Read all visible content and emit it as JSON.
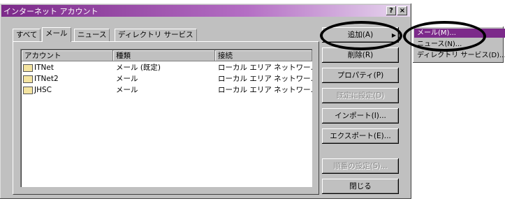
{
  "window": {
    "title": "インターネット アカウント",
    "help_label": "?",
    "close_label": "×"
  },
  "tabs": [
    {
      "label": "すべて"
    },
    {
      "label": "メール"
    },
    {
      "label": "ニュース"
    },
    {
      "label": "ディレクトリ サービス"
    }
  ],
  "columns": [
    "アカウント",
    "種類",
    "接続"
  ],
  "accounts": [
    {
      "name": "ITNet",
      "type": "メール (既定)",
      "connection": "ローカル エリア ネットワー..."
    },
    {
      "name": "ITNet2",
      "type": "メール",
      "connection": "ローカル エリア ネットワー..."
    },
    {
      "name": "JHSC",
      "type": "メール",
      "connection": "ローカル エリア ネットワー..."
    }
  ],
  "buttons": {
    "add": "追加(A)",
    "remove": "削除(R)",
    "properties": "プロパティ(P)",
    "set_default": "既定に設定(D)",
    "import": "インポート(I)...",
    "export": "エクスポート(E)...",
    "set_order": "順番の設定(S)...",
    "close": "閉じる"
  },
  "add_menu": [
    "メール(M)...",
    "ニュース(N)...",
    "ディレクトリ サービス(D)..."
  ],
  "colors": {
    "titlebar": "#7c2a8a",
    "menu_highlight": "#7c2a8a",
    "face": "#c0c0c0"
  }
}
